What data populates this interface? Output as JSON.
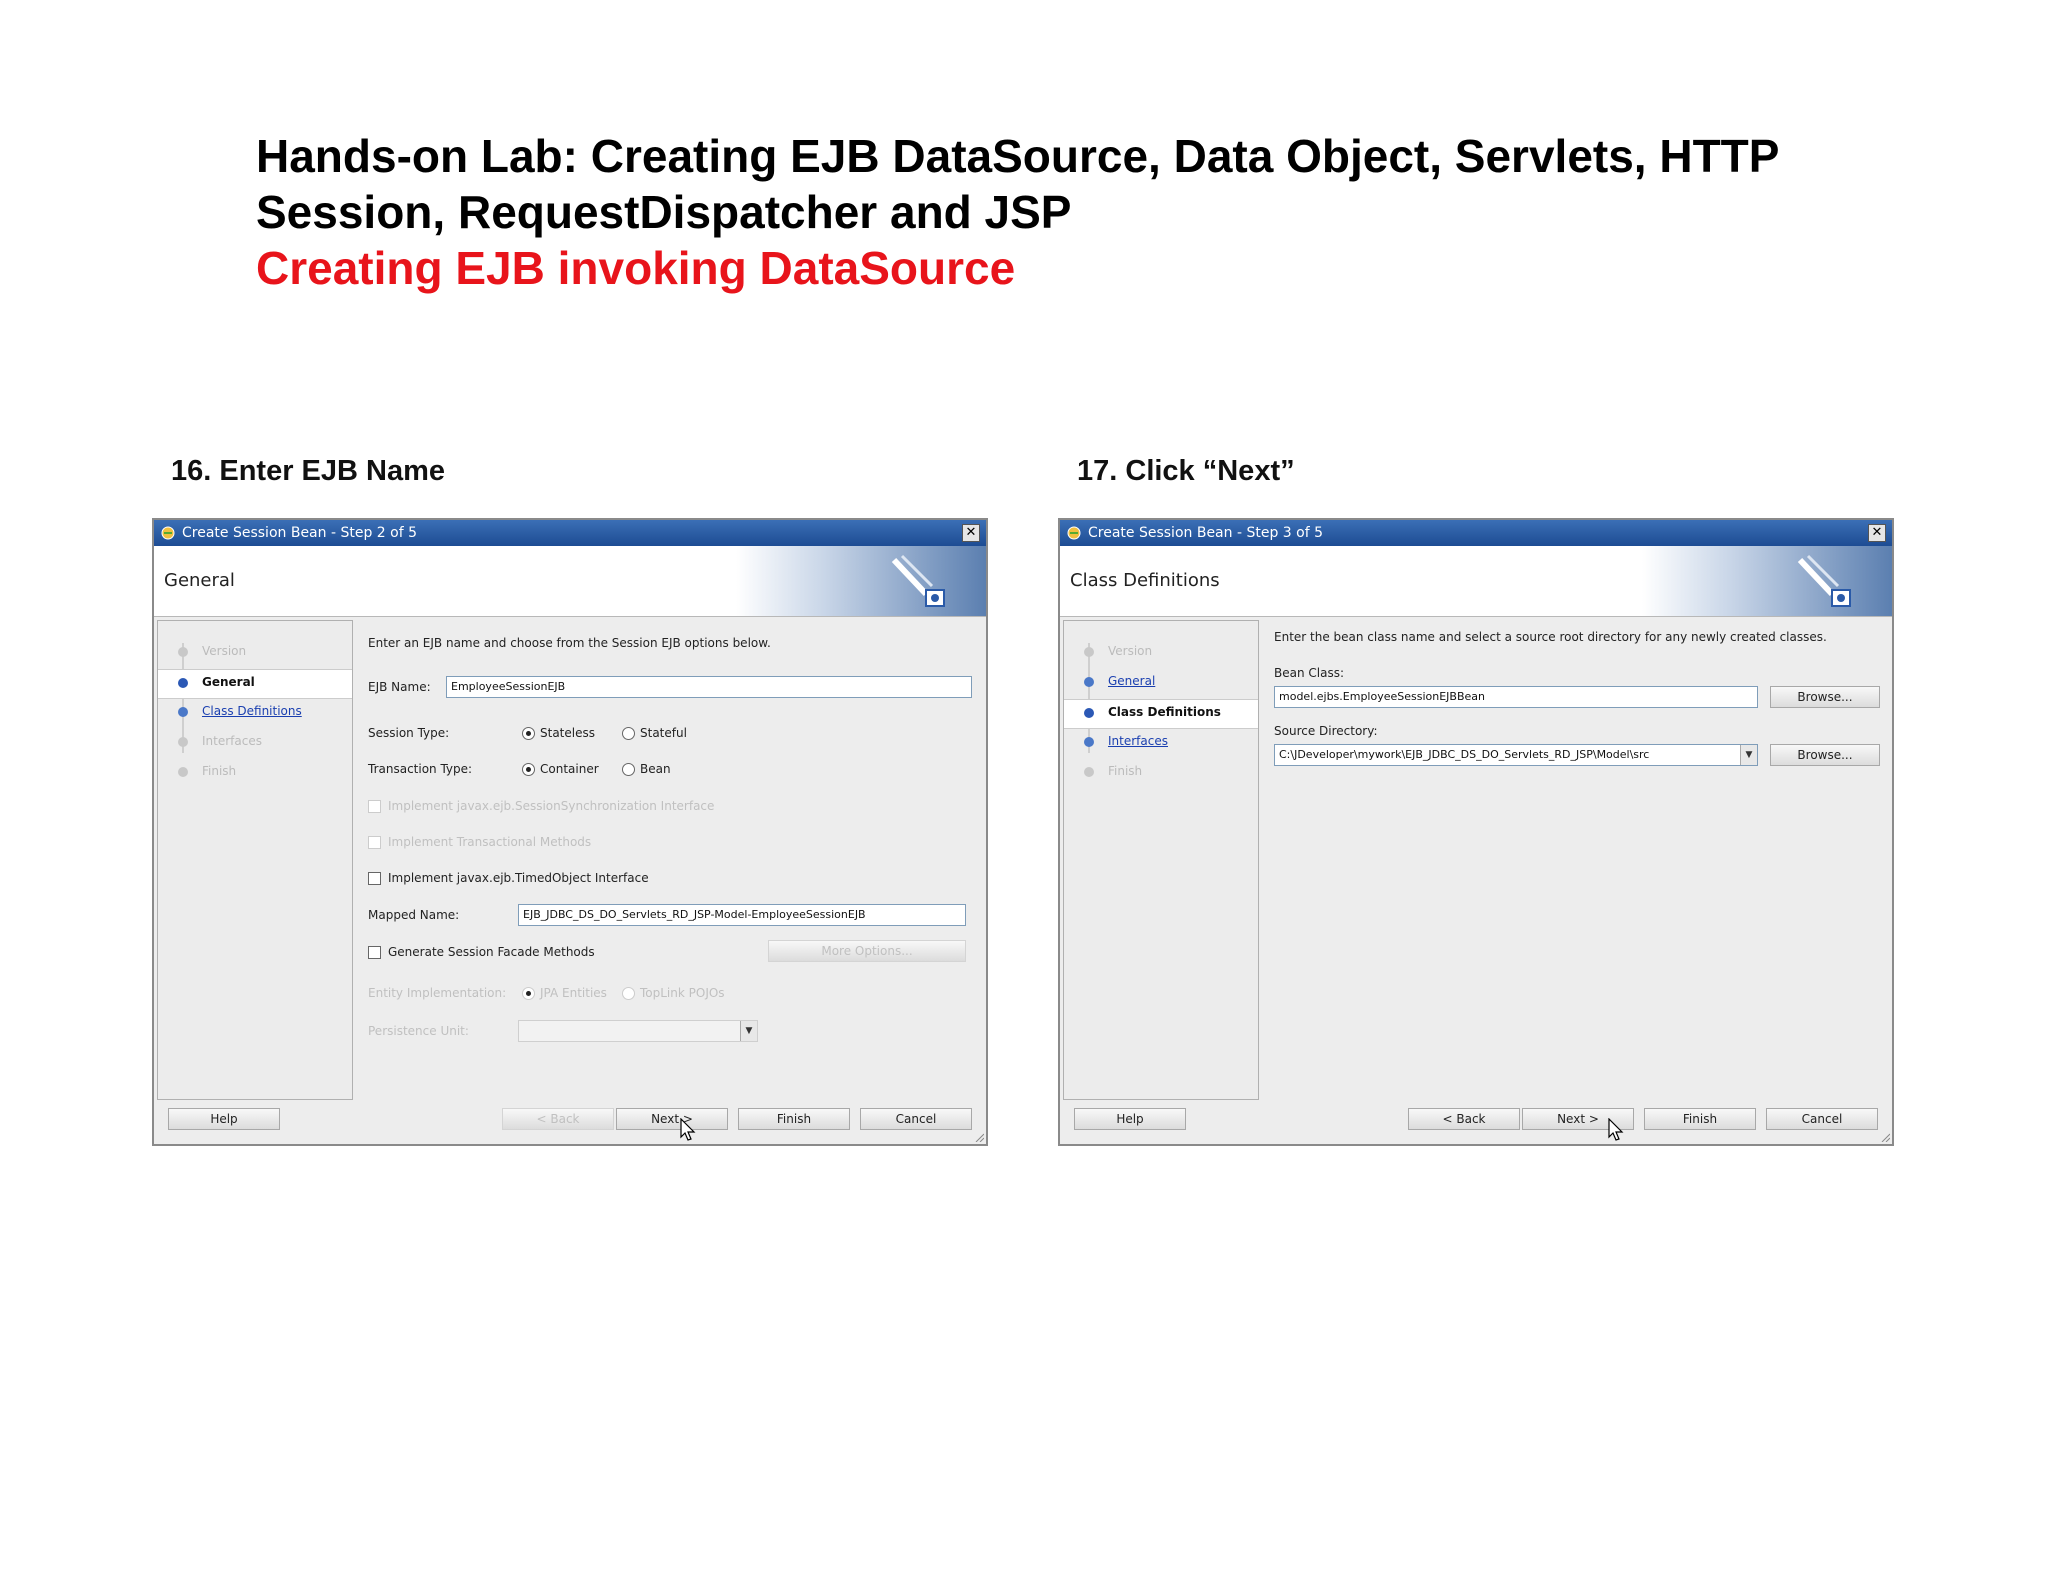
{
  "header": {
    "title_line1": "Hands-on Lab: Creating EJB DataSource, Data Object, Servlets, HTTP",
    "title_line2": "Session, RequestDispatcher and JSP",
    "subtitle": "Creating EJB invoking DataSource"
  },
  "colors": {
    "subtitle": "#e8141b",
    "titlebar": "#1d4c93"
  },
  "steps": [
    {
      "label": "16. Enter EJB Name",
      "dialog": {
        "title": "Create Session Bean - Step 2 of 5",
        "page_header": "General",
        "nav": [
          "Version",
          "General",
          "Class Definitions",
          "Interfaces",
          "Finish"
        ],
        "intro": "Enter an EJB name and choose from the Session EJB options below.",
        "ejb_name_label": "EJB Name:",
        "ejb_name_value": "EmployeeSessionEJB",
        "session_type_label": "Session Type:",
        "session_stateless": "Stateless",
        "session_stateful": "Stateful",
        "transaction_type_label": "Transaction Type:",
        "transaction_container": "Container",
        "transaction_bean": "Bean",
        "opt_sync": "Implement javax.ejb.SessionSynchronization Interface",
        "opt_transactional": "Implement Transactional Methods",
        "opt_timed": "Implement javax.ejb.TimedObject Interface",
        "mapped_name_label": "Mapped Name:",
        "mapped_name_value": "EJB_JDBC_DS_DO_Servlets_RD_JSP-Model-EmployeeSessionEJB",
        "opt_facade": "Generate Session Facade Methods",
        "more_options": "More Options...",
        "entity_impl_label": "Entity Implementation:",
        "entity_jpa": "JPA Entities",
        "entity_toplink": "TopLink POJOs",
        "persistence_unit_label": "Persistence Unit:",
        "buttons": {
          "help": "Help",
          "back": "< Back",
          "next": "Next >",
          "finish": "Finish",
          "cancel": "Cancel"
        }
      }
    },
    {
      "label": "17. Click “Next”",
      "dialog": {
        "title": "Create Session Bean - Step 3 of 5",
        "page_header": "Class Definitions",
        "nav": [
          "Version",
          "General",
          "Class Definitions",
          "Interfaces",
          "Finish"
        ],
        "intro": "Enter the bean class name and select a source root directory for any newly created classes.",
        "bean_class_label": "Bean Class:",
        "bean_class_value": "model.ejbs.EmployeeSessionEJBBean",
        "source_dir_label": "Source Directory:",
        "source_dir_value": "C:\\JDeveloper\\mywork\\EJB_JDBC_DS_DO_Servlets_RD_JSP\\Model\\src",
        "browse": "Browse...",
        "buttons": {
          "help": "Help",
          "back": "< Back",
          "next": "Next >",
          "finish": "Finish",
          "cancel": "Cancel"
        }
      }
    }
  ]
}
